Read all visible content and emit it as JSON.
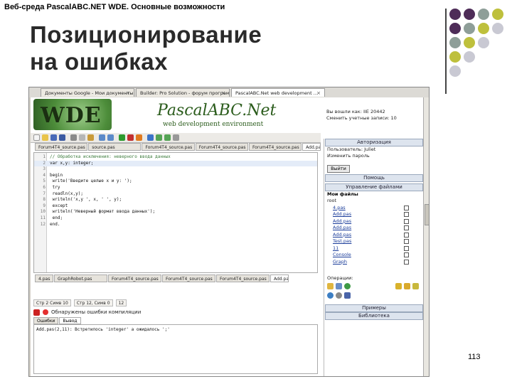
{
  "slide": {
    "header": "Веб-среда PascalABC.NET WDE. Основные возможности",
    "title_line1": "Позиционирование",
    "title_line2": "на ошибках",
    "slide_number": "113",
    "dot_colors": [
      "#4e2c58",
      "#4e2c58",
      "#8e9e98",
      "#bec03c",
      "#4e2c58",
      "#8e9e98",
      "#bec03c",
      "#c9c9d3",
      "#8e9e98",
      "#bec03c",
      "#c9c9d3",
      "#ffffff",
      "#bec03c",
      "#c9c9d3",
      "#ffffff",
      "#ffffff",
      "#c9c9d3",
      "#ffffff",
      "#ffffff",
      "#ffffff"
    ]
  },
  "browser": {
    "tabs": [
      {
        "label": "Документы Google - Мои документы",
        "active": false
      },
      {
        "label": "Builder: Pro Solution - форум программ...",
        "active": false
      },
      {
        "label": "PascalABC.Net web development ...",
        "active": true
      }
    ]
  },
  "banner": {
    "logo": "WDE",
    "product": "PascalABC.Net",
    "subtitle": "web development environment",
    "info_line1": "Вы вошли как: IIE 20442",
    "info_line2": "Сменить учетные записи: 10"
  },
  "file_tabs": [
    {
      "label": "Forum4T4_source.pas",
      "active": false,
      "short": false
    },
    {
      "label": "source.pas",
      "active": false,
      "short": false
    },
    {
      "label": "Forum4T4_source.pas",
      "active": false,
      "short": false
    },
    {
      "label": "Forum4T4_source.pas",
      "active": false,
      "short": false
    },
    {
      "label": "Forum4T4_source.pas",
      "active": false,
      "short": false
    },
    {
      "label": "Add.pas",
      "active": true,
      "short": true
    }
  ],
  "file_tabs_bottom": [
    {
      "label": "4.pas",
      "active": false,
      "short": true
    },
    {
      "label": "GraphRobot.pas",
      "active": false,
      "short": false
    },
    {
      "label": "Forum4T4_source.pas",
      "active": false,
      "short": false
    },
    {
      "label": "Forum4T4_source.pas",
      "active": false,
      "short": false
    },
    {
      "label": "Forum4T4_source.pas",
      "active": false,
      "short": false
    },
    {
      "label": "Add.pas",
      "active": true,
      "short": true
    }
  ],
  "code": [
    {
      "n": "1",
      "text": "// Обработка исключения: неверного ввода данных",
      "cls": "comment"
    },
    {
      "n": "2",
      "text": "var x,y: integer;",
      "cls": "highlight"
    },
    {
      "n": "3",
      "text": "",
      "cls": ""
    },
    {
      "n": "4",
      "text": "begin",
      "cls": ""
    },
    {
      "n": "5",
      "text": "  write('Введите целые x и y: ');",
      "cls": ""
    },
    {
      "n": "6",
      "text": "  try",
      "cls": ""
    },
    {
      "n": "7",
      "text": "    readln(x,y);",
      "cls": ""
    },
    {
      "n": "8",
      "text": "    writeln('x,y ', x, ' ', y);",
      "cls": ""
    },
    {
      "n": "9",
      "text": "  except",
      "cls": ""
    },
    {
      "n": "10",
      "text": "    writeln('Неверный формат ввода данных');",
      "cls": ""
    },
    {
      "n": "11",
      "text": "  end;",
      "cls": ""
    },
    {
      "n": "12",
      "text": "end.",
      "cls": ""
    }
  ],
  "statusbar": {
    "pos": "Стр 2 Симв 10",
    "mode": "Стр 12, Симв 0",
    "lines": "12"
  },
  "errors": {
    "message": "Обнаружены ошибки компиляции",
    "tab_output": "Ошибки",
    "tab_errors": "Вывод",
    "output_text": "Add.pas(2,11): Встретилось 'integer' а ожидалось ';'"
  },
  "panel": {
    "auth_head": "Авторизация",
    "user_line": "Пользователь: Juliet",
    "change_pass": "Изменить пароль",
    "logout_button": "Выйти",
    "help_head": "Помощь",
    "files_head": "Управление файлами",
    "files_title": "Мои файлы",
    "root": "root",
    "files": [
      "4.pas",
      "Add.pas",
      "Add.pas",
      "Add.pas",
      "Add.pas",
      "Test.pas",
      "11",
      "Console",
      "Graph"
    ],
    "ops_label": "Операции:",
    "examples_head": "Примеры",
    "library_head": "Библиотека"
  }
}
